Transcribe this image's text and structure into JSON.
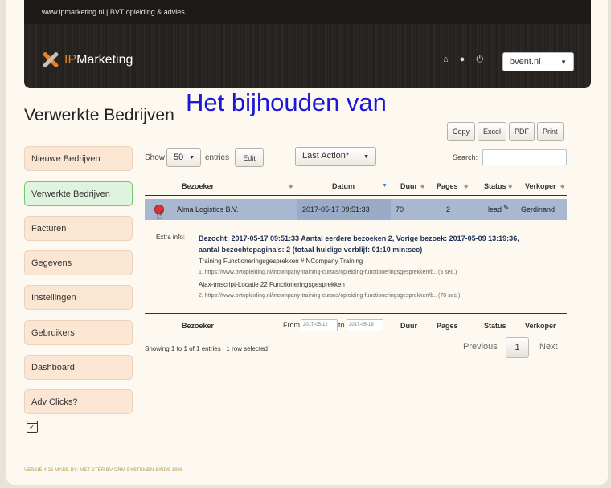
{
  "header": {
    "tagline": "www.ipmarketing.nl | BVT opleiding & advies",
    "logo_prefix": "IP",
    "logo_suffix": "Marketing",
    "icons": [
      "home-icon",
      "user-icon",
      "power-icon"
    ],
    "domain_selected": "bvent.nl"
  },
  "page": {
    "title": "Verwerkte Bedrijven",
    "overlay_title": "Het bijhouden van"
  },
  "export_buttons": [
    "Copy",
    "Excel",
    "PDF",
    "Print"
  ],
  "sidebar": {
    "items": [
      {
        "label": "Nieuwe Bedrijven"
      },
      {
        "label": "Verwerkte Bedrijven"
      },
      {
        "label": "Facturen"
      },
      {
        "label": "Gegevens"
      },
      {
        "label": "Instellingen"
      },
      {
        "label": "Gebruikers"
      },
      {
        "label": "Dashboard"
      },
      {
        "label": "Adv Clicks?"
      }
    ]
  },
  "controls": {
    "show_label": "Show",
    "show_value": "50",
    "entries_label": "entries",
    "edit_label": "Edit",
    "action_label": "Last Action*",
    "search_label": "Search:"
  },
  "table": {
    "columns": [
      "Bezoeker",
      "Datum",
      "Duur",
      "Pages",
      "Status",
      "Verkoper"
    ],
    "rows": [
      {
        "bezoeker": "Alma Logistics B.V.",
        "datum": "2017-05-17 09:51:33",
        "duur": "70",
        "pages": "2",
        "status": "lead",
        "verkoper": "Gerdinand"
      }
    ],
    "extra": {
      "label": "Extra info:",
      "summary_1": "Bezocht: 2017-05-17 09:51:33 Aantal eerdere bezoeken 2, Vorige bezoek: 2017-05-09 13:19:36,",
      "summary_2": "aantal bezochtepagina's: 2 (totaal huidige verblijf: 01:10 min:sec)",
      "page_1_title": "Training Functioneringsgesprekken #INCompany Training",
      "page_1_url": "1. https://www.bvtopleiding.nl/incompany-training-cursus/opleiding-functioneringsgesprekken/b.. (5 sec.)",
      "page_2_title": "Ajax-tmscript-Locatie 22 Functioneringsgesprekken",
      "page_2_url": "2. https://www.bvtopleiding.nl/incompany-training-cursus/opleiding-functioneringsgesprekken/b.. (70 sec.)"
    },
    "footer": {
      "from_label": "From",
      "from_value": "2017-05-12",
      "to_label": "to",
      "to_value": "2017-05-19"
    }
  },
  "pagination": {
    "info": "Showing 1 to 1 of 1 entries",
    "selected": "1 row selected",
    "previous": "Previous",
    "current": "1",
    "next": "Next"
  },
  "footer_text": "VERSIE 4.25 MADE BY: MET STER BV CRM SYSTEMEN SINDS 1988",
  "colors": {
    "accent": "#e8822a",
    "overlay_title": "#1a18d6",
    "selected_row": "#a8b8d0",
    "active_sidebar": "#dff4df"
  }
}
